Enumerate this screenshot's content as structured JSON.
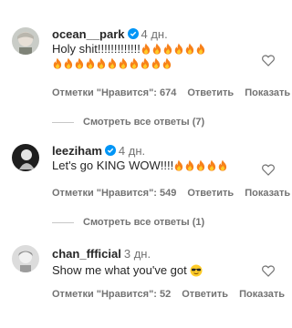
{
  "comments": [
    {
      "username": "ocean__park",
      "verified": true,
      "time": "4 дн.",
      "text": "Holy shit!!!!!!!!!!!!!",
      "emoji": "fire",
      "emoji_count_line1": 6,
      "emoji_count_line2": 11,
      "likes_label": "Отметки \"Нравится\": 674",
      "reply_label": "Ответить",
      "show_label": "Показать",
      "replies_label": "Смотреть все ответы (7)"
    },
    {
      "username": "leeziham",
      "verified": true,
      "time": "4 дн.",
      "text": "Let's go KING WOW!!!!",
      "emoji": "fire",
      "emoji_count_line1": 5,
      "likes_label": "Отметки \"Нравится\": 549",
      "reply_label": "Ответить",
      "show_label": "Показать",
      "replies_label": "Смотреть все ответы (1)"
    },
    {
      "username": "chan_ffficial",
      "verified": false,
      "time": "3 дн.",
      "text": "Show me what you've got",
      "emoji": "sunglasses",
      "likes_label": "Отметки \"Нравится\": 52",
      "reply_label": "Ответить",
      "show_label": "Показать"
    }
  ],
  "colors": {
    "verified": "#0095f6",
    "secondary_text": "#737373",
    "fire_outer": "#f7801a",
    "fire_inner": "#ffcc29"
  }
}
